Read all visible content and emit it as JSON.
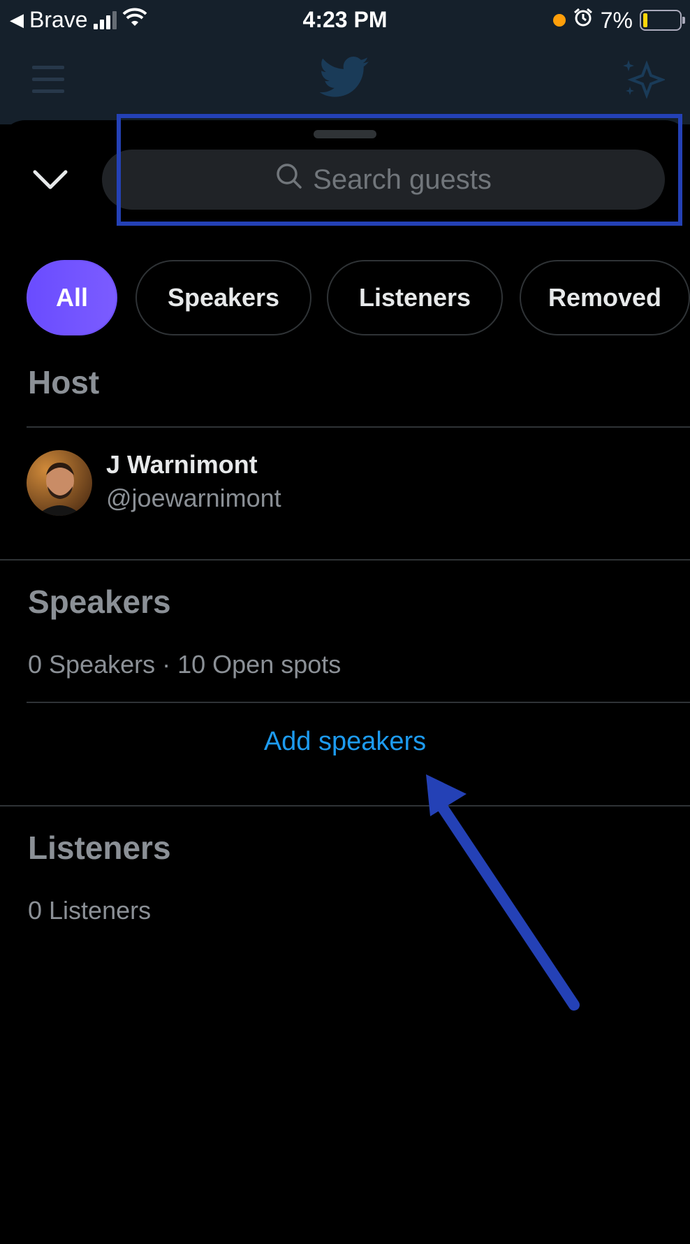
{
  "status_bar": {
    "back_app": "Brave",
    "time": "4:23 PM",
    "battery": "7%"
  },
  "search": {
    "placeholder": "Search guests"
  },
  "filters": [
    {
      "label": "All",
      "active": true
    },
    {
      "label": "Speakers",
      "active": false
    },
    {
      "label": "Listeners",
      "active": false
    },
    {
      "label": "Removed",
      "active": false
    }
  ],
  "host_section": {
    "title": "Host",
    "name": "J Warnimont",
    "handle": "@joewarnimont"
  },
  "speakers_section": {
    "title": "Speakers",
    "summary": "0 Speakers · 10 Open spots",
    "add_label": "Add speakers"
  },
  "listeners_section": {
    "title": "Listeners",
    "summary": "0 Listeners"
  },
  "colors": {
    "accent": "#1d9bf0",
    "active_pill": "#6f52ff",
    "annotation": "#2441b6"
  }
}
